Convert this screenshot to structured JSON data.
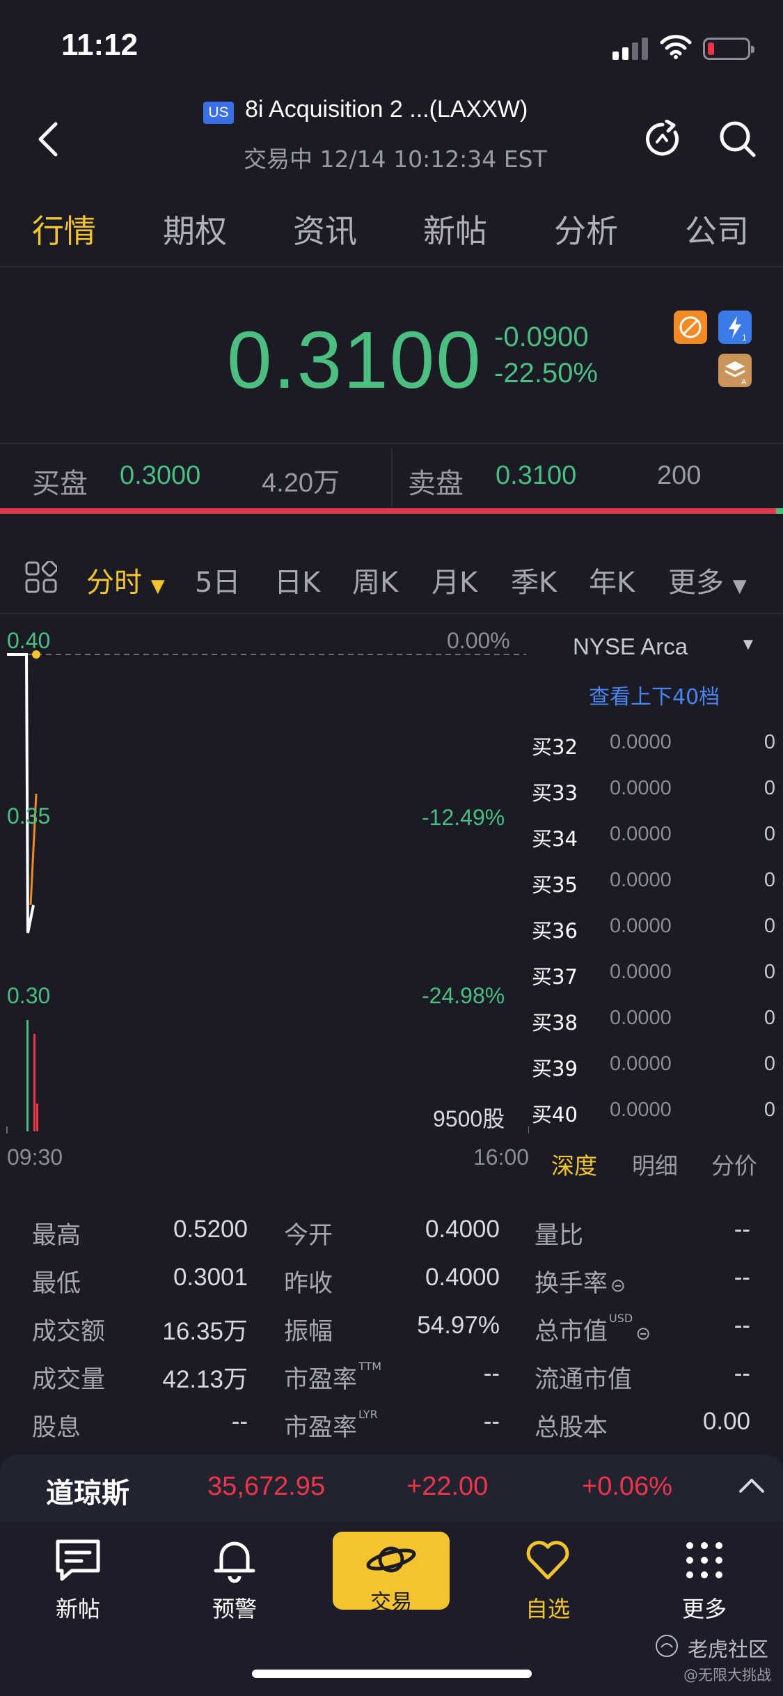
{
  "status_bar": {
    "time": "11:12"
  },
  "header": {
    "market_badge": "US",
    "title": "8i Acquisition 2 ...(LAXXW)",
    "subtitle": "交易中 12/14 10:12:34 EST"
  },
  "tabs": [
    "行情",
    "期权",
    "资讯",
    "新帖",
    "分析",
    "公司"
  ],
  "quote": {
    "price": "0.3100",
    "change": "-0.0900",
    "change_pct": "-22.50%"
  },
  "bid_ask": {
    "bid_label": "买盘",
    "bid_price": "0.3000",
    "bid_size": "4.20万",
    "ask_label": "卖盘",
    "ask_price": "0.3100",
    "ask_size": "200"
  },
  "period_tabs": [
    "分时",
    "5日",
    "日K",
    "周K",
    "月K",
    "季K",
    "年K",
    "更多"
  ],
  "chart": {
    "price_labels": [
      "0.40",
      "0.35",
      "0.30"
    ],
    "pct_labels": [
      "0.00%",
      "-12.49%",
      "-24.98%"
    ],
    "volume_label": "9500股",
    "time_start": "09:30",
    "time_end": "16:00"
  },
  "order_book": {
    "exchange": "NYSE Arca",
    "link": "查看上下40档",
    "rows": [
      {
        "label": "买32",
        "price": "0.0000",
        "vol": "0"
      },
      {
        "label": "买33",
        "price": "0.0000",
        "vol": "0"
      },
      {
        "label": "买34",
        "price": "0.0000",
        "vol": "0"
      },
      {
        "label": "买35",
        "price": "0.0000",
        "vol": "0"
      },
      {
        "label": "买36",
        "price": "0.0000",
        "vol": "0"
      },
      {
        "label": "买37",
        "price": "0.0000",
        "vol": "0"
      },
      {
        "label": "买38",
        "price": "0.0000",
        "vol": "0"
      },
      {
        "label": "买39",
        "price": "0.0000",
        "vol": "0"
      },
      {
        "label": "买40",
        "price": "0.0000",
        "vol": "0"
      }
    ],
    "tabs": [
      "深度",
      "明细",
      "分价"
    ]
  },
  "stats": {
    "col1": [
      {
        "label": "最高",
        "value": "0.5200"
      },
      {
        "label": "最低",
        "value": "0.3001"
      },
      {
        "label": "成交额",
        "value": "16.35万"
      },
      {
        "label": "成交量",
        "value": "42.13万"
      },
      {
        "label": "股息",
        "value": "--"
      }
    ],
    "col2": [
      {
        "label": "今开",
        "value": "0.4000"
      },
      {
        "label": "昨收",
        "value": "0.4000"
      },
      {
        "label": "振幅",
        "value": "54.97%"
      },
      {
        "label": "市盈率",
        "value": "--",
        "sup": "TTM"
      },
      {
        "label": "市盈率",
        "value": "--",
        "sup": "LYR"
      }
    ],
    "col3": [
      {
        "label": "量比",
        "value": "--"
      },
      {
        "label": "换手率",
        "value": "--"
      },
      {
        "label": "总市值",
        "value": "--",
        "sup": "USD"
      },
      {
        "label": "流通市值",
        "value": "--"
      },
      {
        "label": "总股本",
        "value": "0.00"
      }
    ]
  },
  "index_bar": {
    "name": "道琼斯",
    "value": "35,672.95",
    "change": "+22.00",
    "change_pct": "+0.06%"
  },
  "bottom_nav": [
    "新帖",
    "预警",
    "交易",
    "自选",
    "更多"
  ],
  "watermark": {
    "brand": "老虎社区",
    "handle": "@无限大挑战"
  },
  "colors": {
    "up": "#f0354a",
    "down": "#4cbf80",
    "accent": "#f4c430",
    "link": "#4a84f0",
    "bg": "#1a1b25"
  },
  "chart_data": {
    "type": "line",
    "x": [
      "09:30",
      "09:31",
      "09:32",
      "09:33"
    ],
    "series": [
      {
        "values": [
          0.4,
          0.4,
          0.3,
          0.31
        ]
      }
    ],
    "ylim": [
      0.28,
      0.4
    ]
  }
}
